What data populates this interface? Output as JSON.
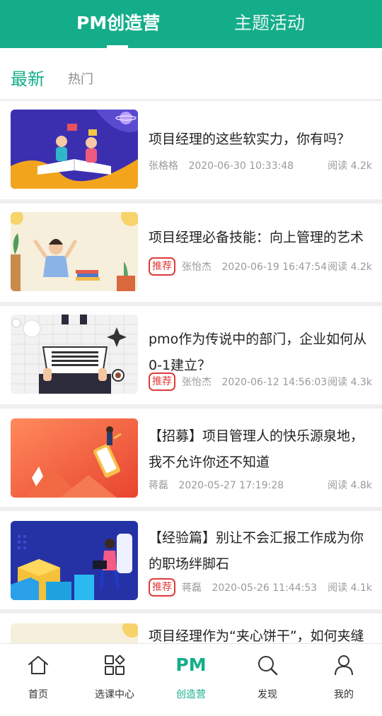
{
  "top_tabs": {
    "active": "PM创造营",
    "other": "主题活动"
  },
  "sub_tabs": {
    "active": "最新",
    "other": "热门"
  },
  "recommend_tag": "推荐",
  "articles": [
    {
      "title": "项目经理的这些软实力，你有吗？",
      "author": "张格格",
      "date": "2020-06-30 10:33:48",
      "reads": "阅读 4.2k",
      "recommended": false
    },
    {
      "title": "项目经理必备技能：向上管理的艺术",
      "author": "张怡杰",
      "date": "2020-06-19 16:47:54",
      "reads": "阅读 4.2k",
      "recommended": true
    },
    {
      "title": "pmo作为传说中的部门，企业如何从0-1建立？",
      "author": "张怡杰",
      "date": "2020-06-12 14:56:03",
      "reads": "阅读 4.3k",
      "recommended": true
    },
    {
      "title": "【招募】项目管理人的快乐源泉地，我不允许你还不知道",
      "author": "蒋磊",
      "date": "2020-05-27 17:19:28",
      "reads": "阅读 4.8k",
      "recommended": false
    },
    {
      "title": "【经验篇】别让不会汇报工作成为你的职场绊脚石",
      "author": "蒋磊",
      "date": "2020-05-26 11:44:53",
      "reads": "阅读 4.1k",
      "recommended": true
    },
    {
      "title": "项目经理作为“夹心饼干”，如何夹缝",
      "author": "",
      "date": "",
      "reads": "",
      "recommended": false
    }
  ],
  "bottom_nav": [
    {
      "label": "首页",
      "icon": "home-icon"
    },
    {
      "label": "选课中心",
      "icon": "grid-icon"
    },
    {
      "label": "创造营",
      "icon": "pm-text-icon",
      "icon_text": "PM",
      "active": true
    },
    {
      "label": "发现",
      "icon": "search-icon"
    },
    {
      "label": "我的",
      "icon": "user-icon"
    }
  ],
  "colors": {
    "accent": "#14ad8a",
    "tag_red": "#e03a3a"
  }
}
